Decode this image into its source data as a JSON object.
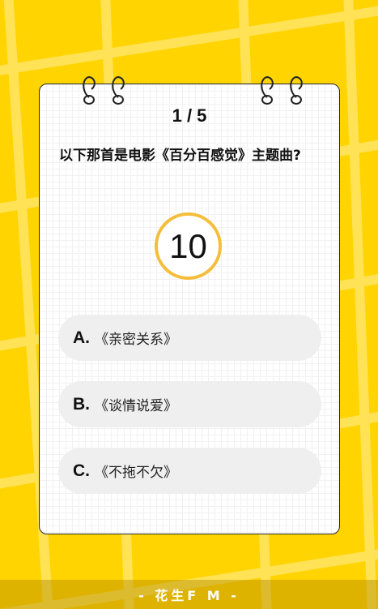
{
  "quiz": {
    "counter": "1 / 5",
    "question": "以下那首是电影《百分百感觉》主题曲?",
    "timer": "10",
    "options": [
      {
        "letter": "A.",
        "text": "《亲密关系》"
      },
      {
        "letter": "B.",
        "text": "《谈情说爱》"
      },
      {
        "letter": "C.",
        "text": "《不拖不欠》"
      }
    ]
  },
  "footer": {
    "label": "- 花生F M -"
  },
  "colors": {
    "background": "#FFD400",
    "timer_ring": "#F4BE3C",
    "option_bg": "#EFEFEF"
  },
  "icons": [
    "notebook-ring-icon"
  ]
}
